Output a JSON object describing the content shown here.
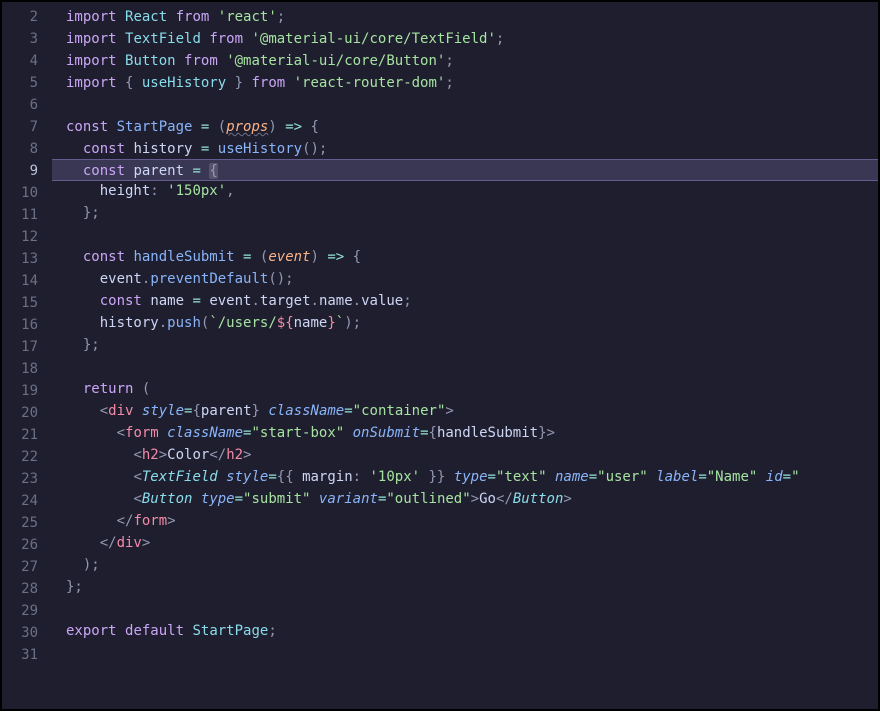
{
  "gutter": {
    "start": 2,
    "end": 31,
    "active": 9
  },
  "code": {
    "l2": {
      "import": "import",
      "React": "React",
      "from": "from",
      "str": "'react'",
      "semi": ";"
    },
    "l3": {
      "import": "import",
      "TextField": "TextField",
      "from": "from",
      "str": "'@material-ui/core/TextField'",
      "semi": ";"
    },
    "l4": {
      "import": "import",
      "Button": "Button",
      "from": "from",
      "str": "'@material-ui/core/Button'",
      "semi": ";"
    },
    "l5": {
      "import": "import",
      "lb": "{ ",
      "useHistory": "useHistory",
      "rb": " }",
      "from": "from",
      "str": "'react-router-dom'",
      "semi": ";"
    },
    "l7": {
      "const": "const",
      "StartPage": "StartPage",
      "eq": " = ",
      "lp": "(",
      "props": "props",
      "rp": ")",
      "arrow": " => ",
      "lb": "{"
    },
    "l8": {
      "const": "const",
      "history": "history",
      "eq": " = ",
      "useHistory": "useHistory",
      "call": "();"
    },
    "l9": {
      "const": "const",
      "parent": "parent",
      "eq": " = ",
      "lb": "{"
    },
    "l10": {
      "height": "height",
      "colon": ": ",
      "val": "'150px'",
      "comma": ","
    },
    "l11": {
      "rb": "};"
    },
    "l13": {
      "const": "const",
      "handleSubmit": "handleSubmit",
      "eq": " = ",
      "lp": "(",
      "event": "event",
      "rp": ")",
      "arrow": " => ",
      "lb": "{"
    },
    "l14": {
      "event": "event",
      "dot": ".",
      "preventDefault": "preventDefault",
      "call": "();"
    },
    "l15": {
      "const": "const",
      "name": "name",
      "eq": " = ",
      "event": "event",
      "dot1": ".",
      "target": "target",
      "dot2": ".",
      "name2": "name",
      "dot3": ".",
      "value": "value",
      "semi": ";"
    },
    "l16": {
      "history": "history",
      "dot": ".",
      "push": "push",
      "lp": "(",
      "tpl_open": "`/users/",
      "dollar": "${",
      "name": "name",
      "close": "}",
      "tpl_close": "`",
      "rp": ");"
    },
    "l17": {
      "rb": "};"
    },
    "l19": {
      "return": "return",
      "lp": " ("
    },
    "l20": {
      "lt": "<",
      "div": "div",
      "sp": " ",
      "style": "style",
      "eq": "=",
      "lb": "{",
      "parent": "parent",
      "rb": "}",
      "sp2": " ",
      "className": "className",
      "eq2": "=",
      "val": "\"container\"",
      "gt": ">"
    },
    "l21": {
      "lt": "<",
      "form": "form",
      "sp": " ",
      "className": "className",
      "eq": "=",
      "val": "\"start-box\"",
      "sp2": " ",
      "onSubmit": "onSubmit",
      "eq2": "=",
      "lb": "{",
      "handleSubmit": "handleSubmit",
      "rb": "}",
      "gt": ">"
    },
    "l22": {
      "lt": "<",
      "h2": "h2",
      "gt": ">",
      "text": "Color",
      "lt2": "</",
      "h2b": "h2",
      "gt2": ">"
    },
    "l23": {
      "lt": "<",
      "TextField": "TextField",
      "sp": " ",
      "style": "style",
      "eq": "=",
      "lbb": "{{ ",
      "margin": "margin",
      "colon": ": ",
      "val": "'10px'",
      "rbb": " }}",
      "sp2": " ",
      "type": "type",
      "eq2": "=",
      "tval": "\"text\"",
      "sp3": " ",
      "name": "name",
      "eq3": "=",
      "nval": "\"user\"",
      "sp4": " ",
      "label": "label",
      "eq4": "=",
      "lval": "\"Name\"",
      "sp5": " ",
      "id": "id",
      "eq5": "=",
      "idval": "\""
    },
    "l24": {
      "lt": "<",
      "Button": "Button",
      "sp": " ",
      "type": "type",
      "eq": "=",
      "tval": "\"submit\"",
      "sp2": " ",
      "variant": "variant",
      "eq2": "=",
      "vval": "\"outlined\"",
      "gt": ">",
      "text": "Go",
      "lt2": "</",
      "Button2": "Button",
      "gt2": ">"
    },
    "l25": {
      "lt": "</",
      "form": "form",
      "gt": ">"
    },
    "l26": {
      "lt": "</",
      "div": "div",
      "gt": ">"
    },
    "l27": {
      "rp": ");"
    },
    "l28": {
      "rb": "};"
    },
    "l30": {
      "export": "export",
      "default": "default",
      "StartPage": "StartPage",
      "semi": ";"
    }
  }
}
